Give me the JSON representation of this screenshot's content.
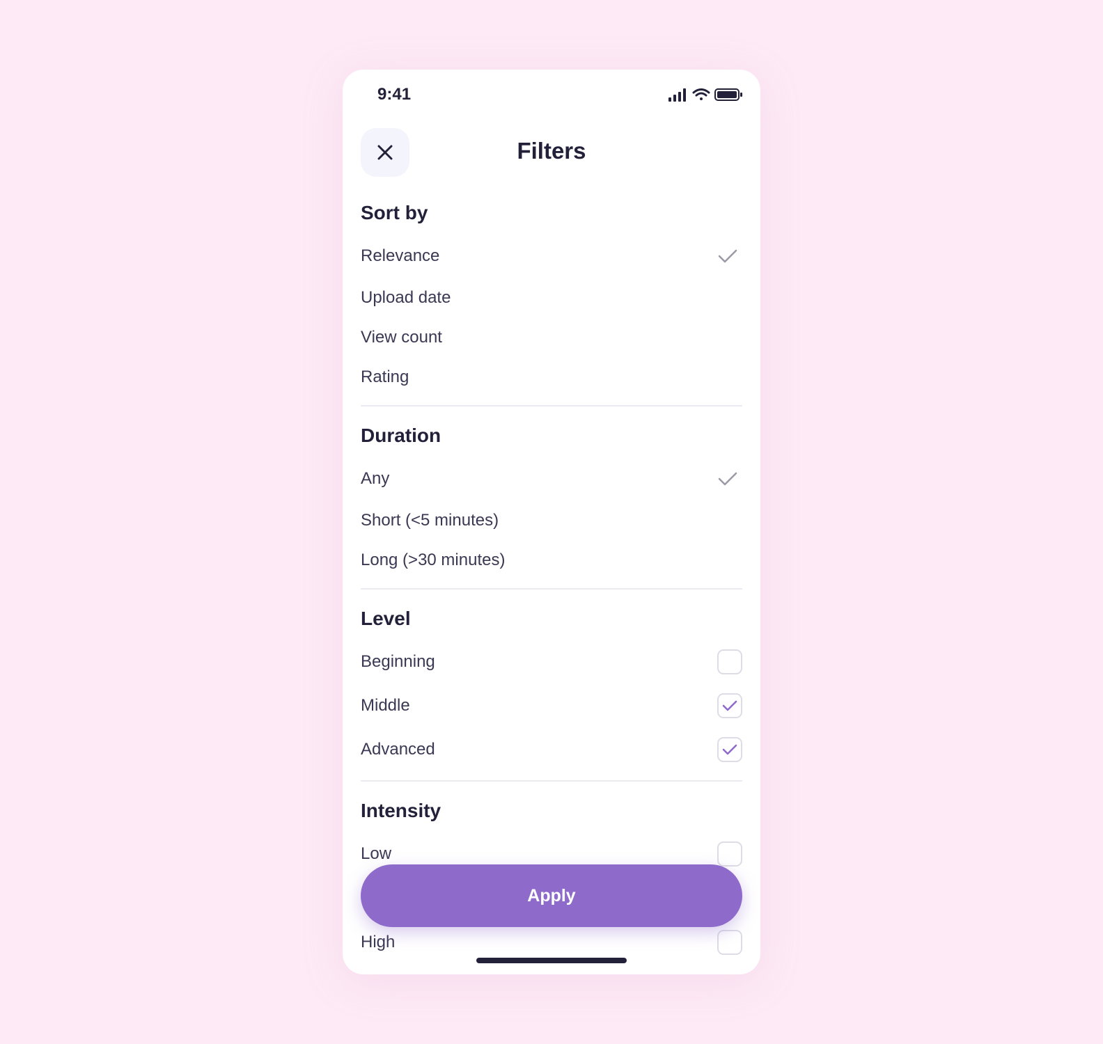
{
  "status_bar": {
    "time": "9:41",
    "icons": [
      "signal-icon",
      "wifi-icon",
      "battery-icon"
    ]
  },
  "header": {
    "title": "Filters",
    "close_icon": "close-icon"
  },
  "sort_by": {
    "title": "Sort by",
    "options": [
      {
        "label": "Relevance",
        "selected": true
      },
      {
        "label": "Upload date",
        "selected": false
      },
      {
        "label": "View count",
        "selected": false
      },
      {
        "label": "Rating",
        "selected": false
      }
    ]
  },
  "duration": {
    "title": "Duration",
    "options": [
      {
        "label": "Any",
        "selected": true
      },
      {
        "label": "Short (<5 minutes)",
        "selected": false
      },
      {
        "label": "Long (>30 minutes)",
        "selected": false
      }
    ]
  },
  "level": {
    "title": "Level",
    "options": [
      {
        "label": "Beginning",
        "checked": false
      },
      {
        "label": "Middle",
        "checked": true
      },
      {
        "label": "Advanced",
        "checked": true
      }
    ]
  },
  "intensity": {
    "title": "Intensity",
    "options": [
      {
        "label": "Low",
        "checked": false
      },
      {
        "label": "High",
        "checked": false
      }
    ]
  },
  "apply_label": "Apply",
  "colors": {
    "background": "#fdeaf6",
    "accent": "#8e6acb",
    "text_dark": "#23203a",
    "check_gray": "#9a99a6"
  }
}
